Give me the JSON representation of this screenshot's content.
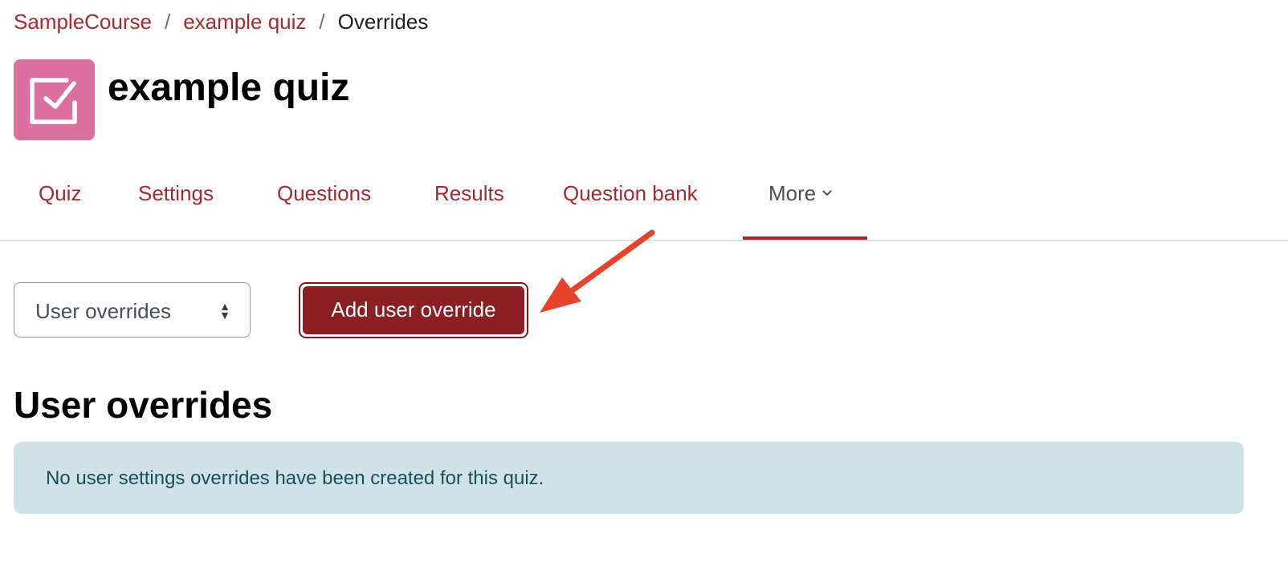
{
  "breadcrumb": {
    "items": [
      "SampleCourse",
      "example quiz",
      "Overrides"
    ],
    "separator": "/"
  },
  "header": {
    "title": "example quiz",
    "icon": "quiz-checkbox-icon",
    "icon_color": "#db6f9f"
  },
  "tabs": [
    {
      "label": "Quiz"
    },
    {
      "label": "Settings"
    },
    {
      "label": "Questions"
    },
    {
      "label": "Results"
    },
    {
      "label": "Question bank"
    },
    {
      "label": "More",
      "active": true
    }
  ],
  "controls": {
    "select_value": "User overrides",
    "add_button": "Add user override"
  },
  "section": {
    "heading": "User overrides",
    "alert": "No user settings overrides have been created for this quiz."
  },
  "colors": {
    "accent": "#a52a30",
    "button": "#8b1f24",
    "alert_bg": "#cfe3e7",
    "annotation_arrow": "#e8432a"
  }
}
